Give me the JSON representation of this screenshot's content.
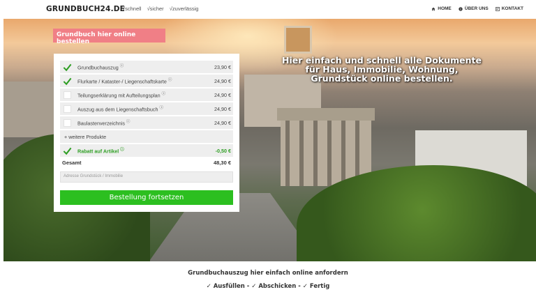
{
  "header": {
    "logo": "GRUNDBUCH24.DE",
    "tagline": [
      "√schnell",
      "√sicher",
      "√zuverlässig"
    ],
    "nav": [
      {
        "label": "HOME",
        "icon": "home-icon"
      },
      {
        "label": "ÜBER UNS",
        "icon": "info-icon"
      },
      {
        "label": "KONTAKT",
        "icon": "contact-icon"
      }
    ]
  },
  "hero": {
    "cta_label": "Grundbuch hier online bestellen",
    "headline": "Hier einfach und schnell alle Dokumente für Haus, Immobilie, Wohnung, Grundstück online bestellen."
  },
  "order": {
    "items": [
      {
        "label": "Grundbuchauszug",
        "price": "23,90 €",
        "checked": true
      },
      {
        "label": "Flurkarte / Kataster-/ Liegenschaftskarte",
        "price": "24,90 €",
        "checked": true
      },
      {
        "label": "Teilungserklärung mit Aufteilungsplan",
        "price": "24,90 €",
        "checked": false
      },
      {
        "label": "Auszug aus dem Liegenschaftsbuch",
        "price": "24,90 €",
        "checked": false
      },
      {
        "label": "Baulastenverzeichnis",
        "price": "24,90 €",
        "checked": false
      }
    ],
    "info_marker": "ⓘ",
    "more_label": "+ weitere Produkte",
    "rabatt_label": "Rabatt auf Artikel",
    "rabatt_value": "-0,50 €",
    "total_label": "Gesamt",
    "total_value": "48,30 €",
    "address_placeholder": "Adresse Grundstück / Immobilie",
    "submit_label": "Bestellung fortsetzen",
    "accent_color": "#2cbf20"
  },
  "footer": {
    "line1": "Grundbuchauszug hier einfach online anfordern",
    "line2": "✓ Ausfüllen - ✓ Abschicken - ✓ Fertig"
  }
}
